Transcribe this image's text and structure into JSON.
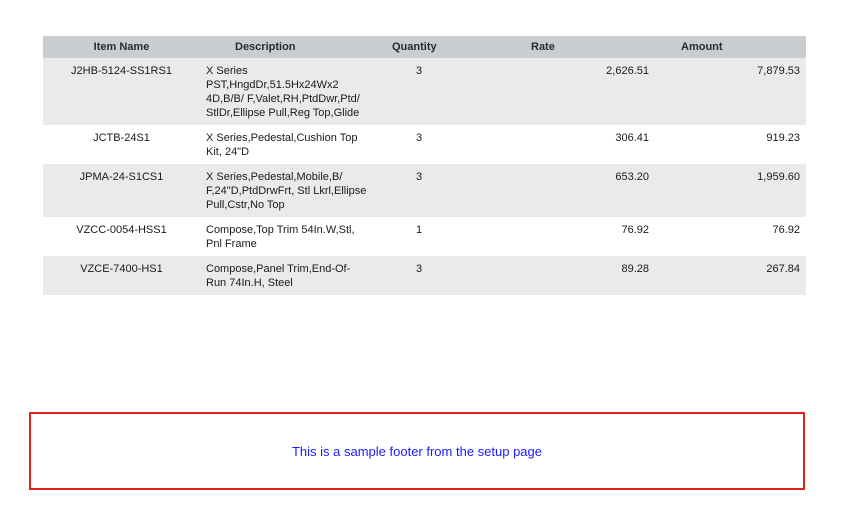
{
  "table": {
    "headers": {
      "item_name": "Item Name",
      "description": "Description",
      "quantity": "Quantity",
      "rate": "Rate",
      "amount": "Amount"
    },
    "rows": [
      {
        "item_name": "J2HB-5124-SS1RS1",
        "description": "X Series PST,HngdDr,51.5Hx24Wx2 4D,B/B/ F,Valet,RH,PtdDwr,Ptd/ StlDr,Ellipse Pull,Reg Top,Glide",
        "quantity": "3",
        "rate": "2,626.51",
        "amount": "7,879.53"
      },
      {
        "item_name": "JCTB-24S1",
        "description": "X Series,Pedestal,Cushion Top Kit, 24\"D",
        "quantity": "3",
        "rate": "306.41",
        "amount": "919.23"
      },
      {
        "item_name": "JPMA-24-S1CS1",
        "description": "X Series,Pedestal,Mobile,B/ F,24\"D,PtdDrwFrt, Stl Lkrl,Ellipse Pull,Cstr,No Top",
        "quantity": "3",
        "rate": "653.20",
        "amount": "1,959.60"
      },
      {
        "item_name": "VZCC-0054-HSS1",
        "description": "Compose,Top Trim 54In.W,Stl, Pnl Frame",
        "quantity": "1",
        "rate": "76.92",
        "amount": "76.92"
      },
      {
        "item_name": "VZCE-7400-HS1",
        "description": "Compose,Panel Trim,End-Of-Run 74In.H, Steel",
        "quantity": "3",
        "rate": "89.28",
        "amount": "267.84"
      }
    ]
  },
  "footer": {
    "text": "This is a sample footer from the setup page"
  },
  "colors": {
    "header_bg": "#c9cdd0",
    "shaded_row_bg": "#e9eaeb",
    "footer_border": "#e0221b",
    "footer_text": "#1a1aff"
  }
}
